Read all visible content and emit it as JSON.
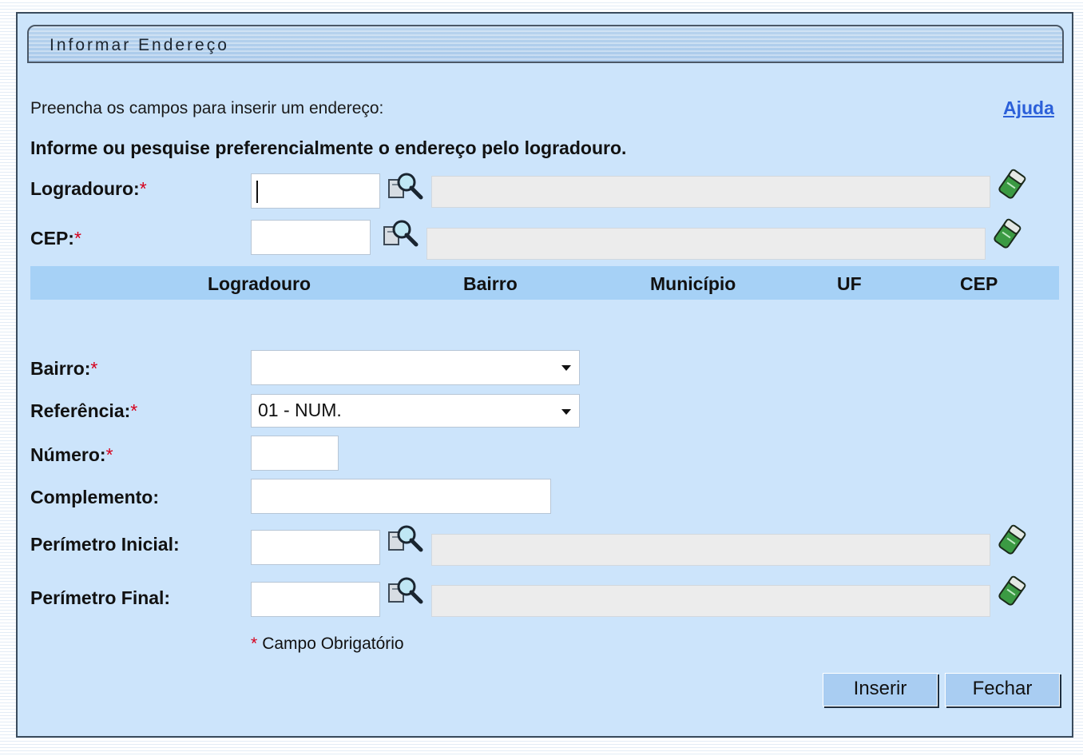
{
  "window": {
    "title": "Informar Endereço"
  },
  "intro": {
    "text": "Preencha os campos para inserir um endereço:",
    "help_link": "Ajuda"
  },
  "instruction": "Informe ou pesquise preferencialmente o endereço pelo logradouro.",
  "required_mark": "*",
  "fields": {
    "logradouro": {
      "label": "Logradouro:",
      "value": "",
      "description": ""
    },
    "cep": {
      "label": "CEP:",
      "value": "",
      "description": ""
    },
    "bairro": {
      "label": "Bairro:",
      "selected": ""
    },
    "referencia": {
      "label": "Referência:",
      "selected": "01 - NUM."
    },
    "numero": {
      "label": "Número:",
      "value": ""
    },
    "complemento": {
      "label": "Complemento:",
      "value": ""
    },
    "perimetro_inicial": {
      "label": "Perímetro Inicial:",
      "value": "",
      "description": ""
    },
    "perimetro_final": {
      "label": "Perímetro Final:",
      "value": "",
      "description": ""
    }
  },
  "table": {
    "columns": [
      "Logradouro",
      "Bairro",
      "Município",
      "UF",
      "CEP"
    ]
  },
  "required_note": "Campo Obrigatório",
  "buttons": {
    "insert": "Inserir",
    "close": "Fechar"
  },
  "colors": {
    "panel_bg": "#cce4fb",
    "header_bg": "#a6d1f6",
    "button_bg": "#a9cdf2",
    "required": "#d6001c",
    "link": "#2b5fd9"
  },
  "icons": {
    "search": "magnifier-icon",
    "clear": "eraser-icon"
  }
}
